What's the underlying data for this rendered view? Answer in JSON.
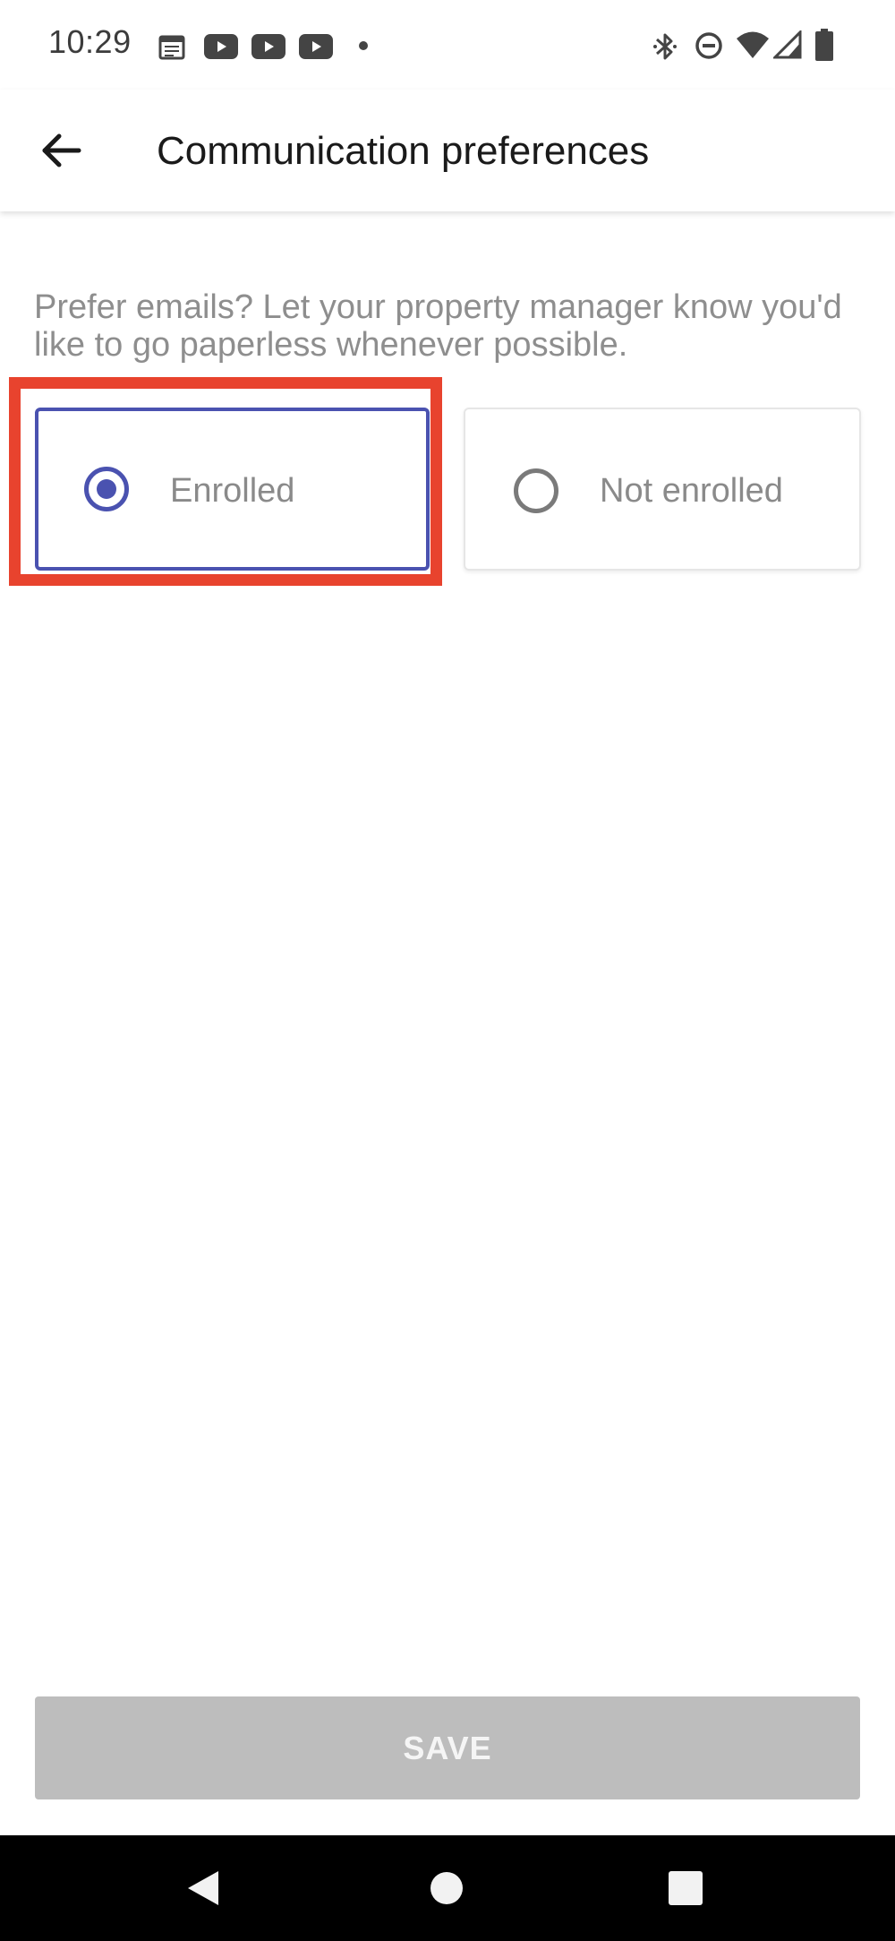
{
  "status_bar": {
    "time": "10:29",
    "left_icons": [
      "calendar-icon",
      "youtube-icon",
      "youtube-icon",
      "youtube-icon",
      "dot-icon"
    ],
    "right_icons": [
      "bluetooth-icon",
      "do-not-disturb-icon",
      "wifi-icon",
      "signal-icon",
      "battery-icon"
    ]
  },
  "app_bar": {
    "back_icon": "arrow-left-icon",
    "title": "Communication preferences"
  },
  "content": {
    "description": "Prefer emails? Let your property manager know you'd like to go paperless whenever possible.",
    "options": [
      {
        "label": "Enrolled",
        "selected": true
      },
      {
        "label": "Not enrolled",
        "selected": false
      }
    ],
    "highlight_color": "#e8432e",
    "accent_color": "#4a52b0"
  },
  "save_button": {
    "label": "SAVE",
    "enabled": false
  },
  "nav_bar": {
    "icons": [
      "back-triangle-icon",
      "home-circle-icon",
      "recents-square-icon"
    ]
  }
}
